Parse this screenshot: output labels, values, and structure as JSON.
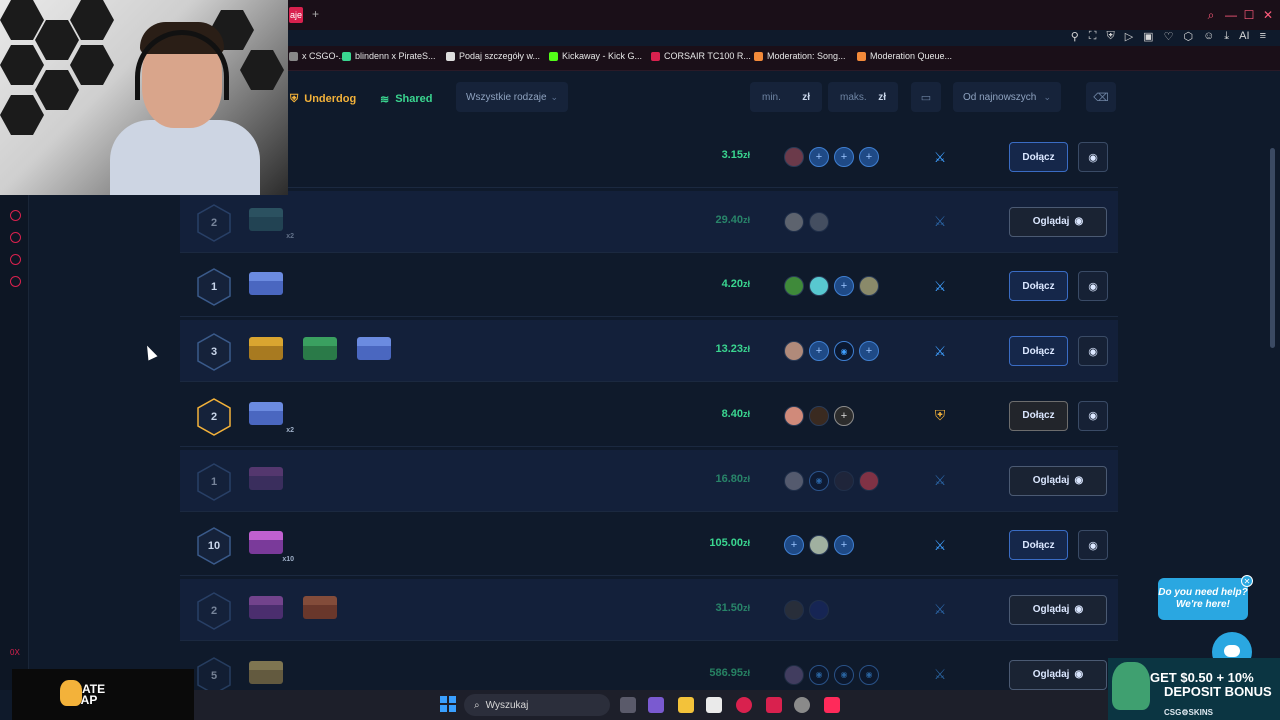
{
  "browser": {
    "tab_label": "aje",
    "bookmarks": [
      {
        "label": "x CSGO-...",
        "color": "#888888"
      },
      {
        "label": "blindenn x PirateS...",
        "color": "#3ad690"
      },
      {
        "label": "Podaj szczegóły w...",
        "color": "#dddddd"
      },
      {
        "label": "Kickaway - Kick G...",
        "color": "#53fc18"
      },
      {
        "label": "CORSAIR TC100 R...",
        "color": "#d9214e"
      },
      {
        "label": "Moderation: Song...",
        "color": "#f38a3a"
      },
      {
        "label": "Moderation Queue...",
        "color": "#f38a3a"
      }
    ],
    "ai_label": "AI"
  },
  "filters": {
    "underdog_label": "Underdog",
    "shared_label": "Shared",
    "type_select": "Wszystkie rodzaje",
    "min_placeholder": "min.",
    "max_placeholder": "maks.",
    "currency": "zł",
    "sort_select": "Od najnowszych"
  },
  "battles": [
    {
      "rounds": "",
      "cases": [],
      "price": "3.15",
      "currency": "zł",
      "players": [
        "av:#6b3a4a",
        "empty",
        "empty",
        "empty"
      ],
      "mode": "swords",
      "action": "Dołącz",
      "dim": false,
      "gold": false
    },
    {
      "rounds": "2",
      "cases": [
        {
          "lid": "#3f7a80",
          "body": "#2f6068",
          "mult": "x2"
        }
      ],
      "price": "29.40",
      "currency": "zł",
      "players": [
        "av:#9a9a9a",
        "av:#6c7480"
      ],
      "mode": "swords",
      "action": "Oglądaj",
      "dim": true,
      "gold": false
    },
    {
      "rounds": "1",
      "cases": [
        {
          "lid": "#6b8be0",
          "body": "#4a67c0",
          "mult": ""
        }
      ],
      "price": "4.20",
      "currency": "zł",
      "players": [
        "av:#3f8a3a",
        "av:#58c8d0",
        "empty",
        "av:#8a8a6a"
      ],
      "mode": "swords",
      "action": "Dołącz",
      "dim": false,
      "gold": false
    },
    {
      "rounds": "3",
      "cases": [
        {
          "lid": "#d9a530",
          "body": "#a87a20",
          "mult": ""
        },
        {
          "lid": "#3aa060",
          "body": "#2a7a48",
          "mult": ""
        },
        {
          "lid": "#6b8be0",
          "body": "#4a67c0",
          "mult": ""
        }
      ],
      "price": "13.23",
      "currency": "zł",
      "players": [
        "av:#b08a7a",
        "empty",
        "bot",
        "empty"
      ],
      "mode": "swords",
      "action": "Dołącz",
      "dim": false,
      "gold": false
    },
    {
      "rounds": "2",
      "cases": [
        {
          "lid": "#6b8be0",
          "body": "#4a67c0",
          "mult": "x2"
        }
      ],
      "price": "8.40",
      "currency": "zł",
      "players": [
        "av:#d08a7a",
        "av:#3a2a20",
        "empty-gold"
      ],
      "mode": "shield",
      "action": "Dołącz",
      "dim": false,
      "gold": true
    },
    {
      "rounds": "1",
      "cases": [
        {
          "lid": "#8a4a9a",
          "body": "#5a3a7a",
          "mult": ""
        }
      ],
      "price": "16.80",
      "currency": "zł",
      "players": [
        "av:#8a8a9a",
        "bot",
        "av:#2a2a3a",
        "av:#d9414e"
      ],
      "mode": "swords",
      "action": "Oglądaj",
      "dim": true,
      "gold": false
    },
    {
      "rounds": "10",
      "cases": [
        {
          "lid": "#c060d0",
          "body": "#7a3a9a",
          "mult": "x10"
        }
      ],
      "price": "105.00",
      "currency": "zł",
      "players": [
        "empty",
        "av:#a0b0a0",
        "empty"
      ],
      "mode": "swords",
      "action": "Dołącz",
      "dim": false,
      "gold": false
    },
    {
      "rounds": "2",
      "cases": [
        {
          "lid": "#c060d0",
          "body": "#7a3a9a",
          "mult": ""
        },
        {
          "lid": "#e0703a",
          "body": "#b04a20",
          "mult": ""
        }
      ],
      "price": "31.50",
      "currency": "zł",
      "players": [
        "av:#3a3a3a",
        "av:#1a2a6a"
      ],
      "mode": "swords",
      "action": "Oglądaj",
      "dim": true,
      "gold": false
    },
    {
      "rounds": "5",
      "cases": [
        {
          "lid": "#d9c070",
          "body": "#a89050",
          "mult": ""
        }
      ],
      "price": "586.95",
      "currency": "zł",
      "players": [
        "av:#6a5a8a",
        "bot",
        "bot",
        "bot"
      ],
      "mode": "swords",
      "action": "Oglądaj",
      "dim": true,
      "gold": false
    }
  ],
  "help": {
    "line1": "Do you need help?",
    "line2": "We're here!"
  },
  "promo": {
    "line1": "GET $0.50 + 10%",
    "line2": "DEPOSIT BONUS",
    "brand": "CSG⚙SKINS"
  },
  "pirate_logo": {
    "line1": "PIRATE",
    "line2": "SWAP"
  },
  "taskbar": {
    "search_label": "Wyszukaj"
  },
  "colors": {
    "accent_gold": "#f3b23a",
    "accent_green": "#3ad690",
    "accent_blue": "#3f9fff"
  }
}
